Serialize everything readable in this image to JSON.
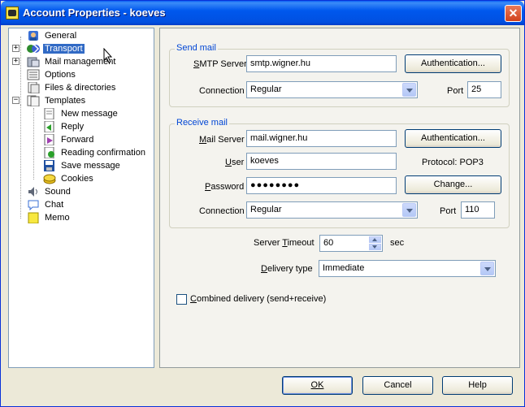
{
  "window": {
    "title": "Account Properties - koeves"
  },
  "tree": {
    "items": [
      {
        "label": "General",
        "icon": "general-icon"
      },
      {
        "label": "Transport",
        "icon": "transport-icon",
        "selected": true
      },
      {
        "label": "Mail management",
        "icon": "mail-management-icon"
      },
      {
        "label": "Options",
        "icon": "options-icon"
      },
      {
        "label": "Files & directories",
        "icon": "files-icon"
      },
      {
        "label": "Templates",
        "icon": "templates-icon"
      },
      {
        "label": "New message",
        "icon": "new-message-icon"
      },
      {
        "label": "Reply",
        "icon": "reply-icon"
      },
      {
        "label": "Forward",
        "icon": "forward-icon"
      },
      {
        "label": "Reading confirmation",
        "icon": "reading-confirmation-icon"
      },
      {
        "label": "Save message",
        "icon": "save-message-icon"
      },
      {
        "label": "Cookies",
        "icon": "cookies-icon"
      },
      {
        "label": "Sound",
        "icon": "sound-icon"
      },
      {
        "label": "Chat",
        "icon": "chat-icon"
      },
      {
        "label": "Memo",
        "icon": "memo-icon"
      }
    ]
  },
  "send_mail": {
    "title": "Send mail",
    "smtp_label_pre": "S",
    "smtp_label_post": "MTP Server",
    "smtp_value": "smtp.wigner.hu",
    "auth_label": "Authentication...",
    "connection_label": "Connection",
    "connection_value": "Regular",
    "port_label": "Port",
    "port_value": "25"
  },
  "receive_mail": {
    "title": "Receive mail",
    "server_label_pre": "M",
    "server_label_post": "ail Server",
    "server_value": "mail.wigner.hu",
    "auth_label": "Authentication...",
    "user_label_pre": "U",
    "user_label_post": "ser",
    "user_value": "koeves",
    "protocol_label": "Protocol:",
    "protocol_value": "POP3",
    "password_label_pre": "P",
    "password_label_post": "assword",
    "password_value": "●●●●●●●●",
    "change_label": "Change...",
    "connection_label": "Connection",
    "connection_value": "Regular",
    "port_label": "Port",
    "port_value": "110"
  },
  "misc": {
    "timeout_label_pre": "Server ",
    "timeout_label_u": "T",
    "timeout_label_post": "imeout",
    "timeout_value": "60",
    "timeout_unit": "sec",
    "delivery_label_u": "D",
    "delivery_label_post": "elivery type",
    "delivery_value": "Immediate",
    "combined_label_u": "C",
    "combined_label_post": "ombined delivery (send+receive)"
  },
  "footer": {
    "ok_label": "OK",
    "cancel_label": "Cancel",
    "help_label": "Help"
  }
}
